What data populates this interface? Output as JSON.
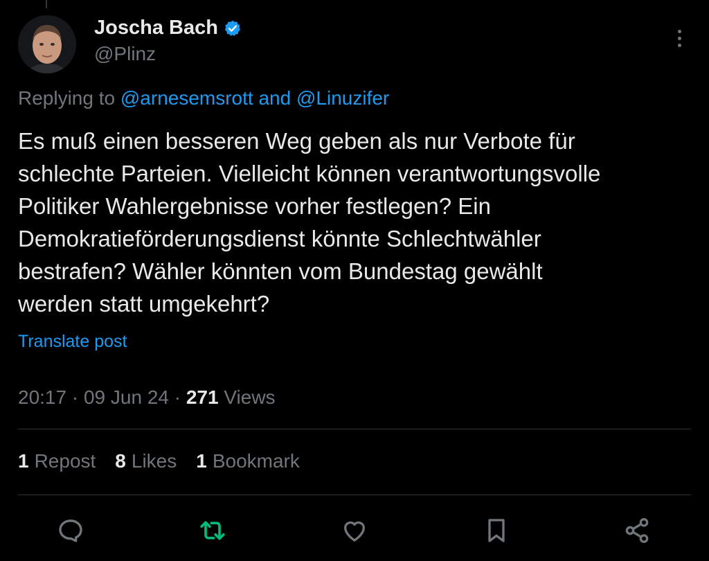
{
  "author": {
    "display_name": "Joscha Bach",
    "handle": "@Plinz",
    "verified_icon": "verified-badge-icon"
  },
  "reply": {
    "prefix": "Replying to ",
    "mention_1": "@arnesemsrott",
    "conjunction": " and ",
    "mention_2": "@Linuzifer"
  },
  "tweet": {
    "lines": [
      "Es muß einen besseren Weg geben als nur Verbote für",
      "schlechte Parteien. Vielleicht können verantwortungsvolle",
      "Politiker Wahlergebnisse vorher festlegen? Ein",
      "Demokratieförderungsdienst könnte Schlechtwähler",
      "bestrafen? Wähler könnten vom Bundestag gewählt",
      "werden statt umgekehrt?"
    ],
    "translate_label": "Translate post"
  },
  "meta": {
    "time": "20:17",
    "separator": " · ",
    "date": "09 Jun 24",
    "views_count": "271",
    "views_label": " Views"
  },
  "stats": {
    "reposts_count": "1",
    "reposts_label": "Repost",
    "likes_count": "8",
    "likes_label": "Likes",
    "bookmarks_count": "1",
    "bookmarks_label": "Bookmark"
  },
  "actions": [
    "reply-icon",
    "repost-icon",
    "like-icon",
    "bookmark-icon",
    "share-icon"
  ],
  "colors": {
    "background": "#000000",
    "text": "#e7e9ea",
    "secondary": "#71767b",
    "link": "#1d9bf0",
    "repost_active": "#00ba7c",
    "divider": "#2f3336"
  }
}
